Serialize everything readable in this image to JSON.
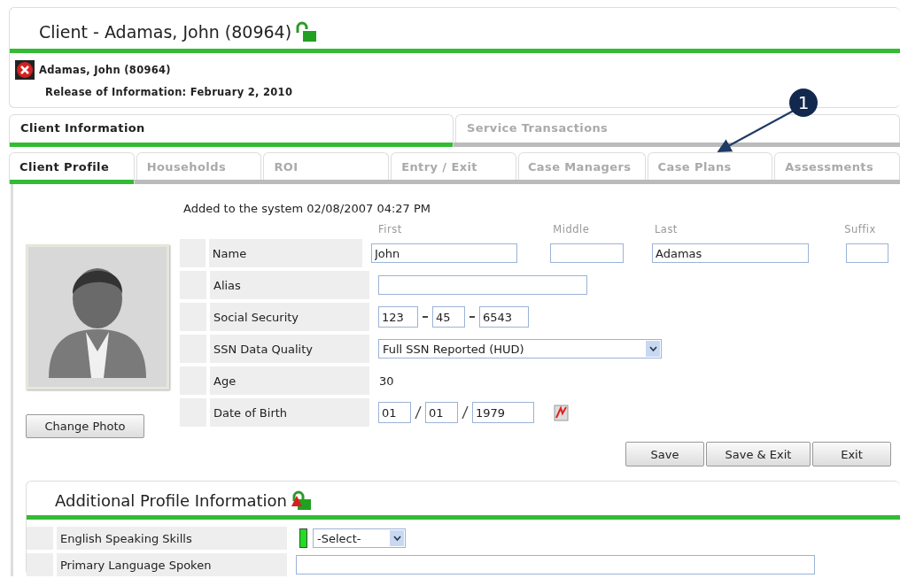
{
  "header": {
    "title": "Client - Adamas, John (80964)"
  },
  "client": {
    "name": "Adamas, John (80964)",
    "roi": "Release of Information: February 2, 2010"
  },
  "tabs": [
    {
      "label": "Client Information",
      "selected": true
    },
    {
      "label": "Service Transactions",
      "selected": false
    }
  ],
  "subtabs": [
    {
      "label": "Client Profile",
      "selected": true
    },
    {
      "label": "Households",
      "selected": false
    },
    {
      "label": "ROI",
      "selected": false
    },
    {
      "label": "Entry / Exit",
      "selected": false
    },
    {
      "label": "Case Managers",
      "selected": false
    },
    {
      "label": "Case Plans",
      "selected": false
    },
    {
      "label": "Assessments",
      "selected": false
    }
  ],
  "callout": {
    "number": "1"
  },
  "profile": {
    "added": "Added to the system 02/08/2007 04:27 PM",
    "photo_button": "Change Photo",
    "rows": [
      {
        "kind": "name",
        "label": "Name",
        "fields": [
          {
            "heading": "First",
            "value": "John"
          },
          {
            "heading": "Middle"
          },
          {
            "heading": "Last",
            "value": "Adamas"
          },
          {
            "heading": "Suffix"
          }
        ]
      },
      {
        "kind": "text",
        "label": "Alias"
      },
      {
        "kind": "ssn",
        "label": "Social Security",
        "parts": [
          "123",
          "45",
          "6543"
        ]
      },
      {
        "kind": "select",
        "label": "SSN Data Quality",
        "value": "Full SSN Reported (HUD)"
      },
      {
        "kind": "static",
        "label": "Age",
        "value": "30"
      },
      {
        "kind": "date",
        "label": "Date of Birth",
        "parts": [
          "01",
          "01",
          "1979"
        ]
      }
    ]
  },
  "buttons": [
    "Save",
    "Save & Exit",
    "Exit"
  ],
  "additional": {
    "title": "Additional Profile Information",
    "rows": [
      {
        "kind": "select",
        "label": "English Speaking Skills",
        "value": "-Select-",
        "required": true
      },
      {
        "kind": "text",
        "label": "Primary Language Spoken",
        "required": false
      }
    ]
  }
}
